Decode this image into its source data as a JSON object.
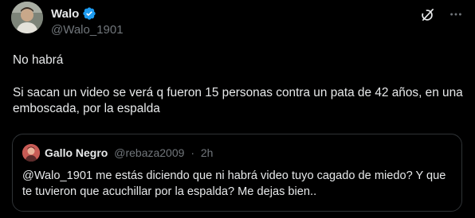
{
  "author": {
    "display_name": "Walo",
    "handle": "@Walo_1901",
    "verified": true
  },
  "toolbar": {
    "icons": [
      "grok-icon",
      "more-icon"
    ]
  },
  "tweet": {
    "paragraph_1": "No habrá",
    "paragraph_2": "Si sacan un video se verá q fueron 15 personas contra un pata de 42 años, en una emboscada, por la espalda"
  },
  "quote": {
    "display_name": "Gallo Negro",
    "handle": "@rebaza2009",
    "separator": "·",
    "time": "2h",
    "text": "@Walo_1901 me estás diciendo que ni habrá video tuyo cagado de miedo? Y que te tuvieron que acuchillar por la espalda? Me dejas bien.."
  },
  "colors": {
    "background": "#000000",
    "text": "#e7e9ea",
    "secondary": "#71767b",
    "verified": "#1d9bf0",
    "border": "#2f3336"
  }
}
